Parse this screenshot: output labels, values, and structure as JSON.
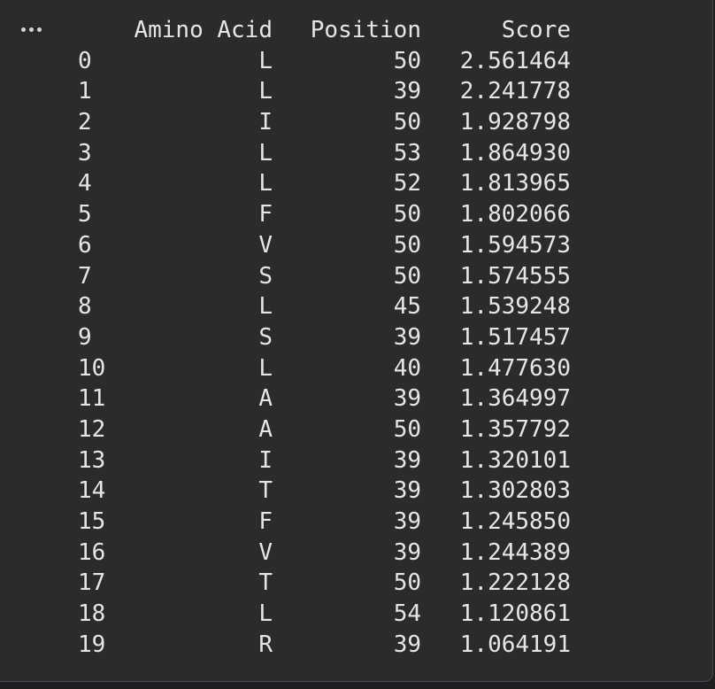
{
  "output": {
    "menu_icon": "ellipsis-icon",
    "columns": [
      "Amino Acid",
      "Position",
      "Score"
    ],
    "rows": [
      {
        "index": "0",
        "amino_acid": "L",
        "position": "50",
        "score": "2.561464"
      },
      {
        "index": "1",
        "amino_acid": "L",
        "position": "39",
        "score": "2.241778"
      },
      {
        "index": "2",
        "amino_acid": "I",
        "position": "50",
        "score": "1.928798"
      },
      {
        "index": "3",
        "amino_acid": "L",
        "position": "53",
        "score": "1.864930"
      },
      {
        "index": "4",
        "amino_acid": "L",
        "position": "52",
        "score": "1.813965"
      },
      {
        "index": "5",
        "amino_acid": "F",
        "position": "50",
        "score": "1.802066"
      },
      {
        "index": "6",
        "amino_acid": "V",
        "position": "50",
        "score": "1.594573"
      },
      {
        "index": "7",
        "amino_acid": "S",
        "position": "50",
        "score": "1.574555"
      },
      {
        "index": "8",
        "amino_acid": "L",
        "position": "45",
        "score": "1.539248"
      },
      {
        "index": "9",
        "amino_acid": "S",
        "position": "39",
        "score": "1.517457"
      },
      {
        "index": "10",
        "amino_acid": "L",
        "position": "40",
        "score": "1.477630"
      },
      {
        "index": "11",
        "amino_acid": "A",
        "position": "39",
        "score": "1.364997"
      },
      {
        "index": "12",
        "amino_acid": "A",
        "position": "50",
        "score": "1.357792"
      },
      {
        "index": "13",
        "amino_acid": "I",
        "position": "39",
        "score": "1.320101"
      },
      {
        "index": "14",
        "amino_acid": "T",
        "position": "39",
        "score": "1.302803"
      },
      {
        "index": "15",
        "amino_acid": "F",
        "position": "39",
        "score": "1.245850"
      },
      {
        "index": "16",
        "amino_acid": "V",
        "position": "39",
        "score": "1.244389"
      },
      {
        "index": "17",
        "amino_acid": "T",
        "position": "50",
        "score": "1.222128"
      },
      {
        "index": "18",
        "amino_acid": "L",
        "position": "54",
        "score": "1.120861"
      },
      {
        "index": "19",
        "amino_acid": "R",
        "position": "39",
        "score": "1.064191"
      }
    ]
  }
}
